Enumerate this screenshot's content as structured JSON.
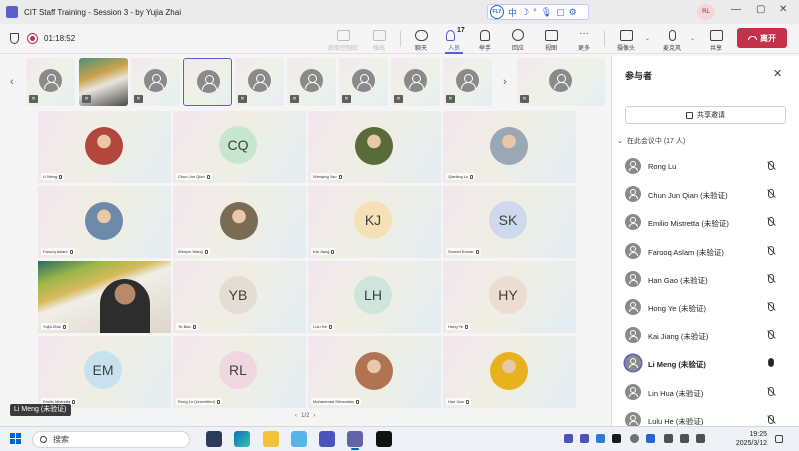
{
  "window": {
    "title": "CIT Staff Training - Session 3 - by Yujia Zhai",
    "user_initials": "RL"
  },
  "input_indicator": {
    "badge": "FLY",
    "glyphs": [
      "中",
      "☽",
      "°",
      "🎙",
      "▢",
      "⚙"
    ]
  },
  "toolbar": {
    "timer": "01:18:52",
    "buttons": [
      {
        "id": "take-control",
        "label": "获取控制权",
        "disabled": true
      },
      {
        "id": "popout",
        "label": "弹出",
        "disabled": true
      },
      {
        "id": "chat",
        "label": "聊天"
      },
      {
        "id": "people",
        "label": "人员",
        "count": "17",
        "active": true
      },
      {
        "id": "raise-hand",
        "label": "举手"
      },
      {
        "id": "react",
        "label": "回应"
      },
      {
        "id": "view",
        "label": "视图"
      },
      {
        "id": "more",
        "label": "更多"
      },
      {
        "id": "camera",
        "label": "摄像头"
      },
      {
        "id": "mic",
        "label": "麦克风"
      },
      {
        "id": "share",
        "label": "共享"
      }
    ],
    "leave_label": "离开"
  },
  "grid": {
    "tiles": [
      {
        "name": "Li Meng",
        "type": "photo",
        "color": "#b3473e"
      },
      {
        "name": "Chun Jun Qian",
        "type": "initials",
        "initials": "CQ",
        "bg": "#c8e6cf"
      },
      {
        "name": "Wenqing Yao",
        "type": "photo",
        "color": "#5a6b3a"
      },
      {
        "name": "Qianling Lu",
        "type": "photo",
        "color": "#9aa7b5"
      },
      {
        "name": "Farooq Aslam",
        "type": "photo",
        "color": "#6d8aa8"
      },
      {
        "name": "Wenyin Wang",
        "type": "photo",
        "color": "#7a6b55"
      },
      {
        "name": "Kai Jiang",
        "type": "initials",
        "initials": "KJ",
        "bg": "#f6e0b8"
      },
      {
        "name": "Suresh Kumar",
        "type": "initials",
        "initials": "SK",
        "bg": "#cfd9ee"
      },
      {
        "name": "Yujia Zhai",
        "type": "video"
      },
      {
        "name": "Ye Bao",
        "type": "initials",
        "initials": "YB",
        "bg": "#e4ddd2"
      },
      {
        "name": "Lulu He",
        "type": "initials",
        "initials": "LH",
        "bg": "#cfe4dd"
      },
      {
        "name": "Hong Ye",
        "type": "initials",
        "initials": "HY",
        "bg": "#ecdcd2"
      },
      {
        "name": "Emilio Mistretta",
        "type": "initials",
        "initials": "EM",
        "bg": "#c7e2ee"
      },
      {
        "name": "Rong Lu (Unverified)",
        "type": "initials",
        "initials": "RL",
        "bg": "#efd6df"
      },
      {
        "name": "Mohammad Shirzadian",
        "type": "photo",
        "color": "#b07453"
      },
      {
        "name": "Han Gao",
        "type": "photo",
        "color": "#e8b21e"
      }
    ]
  },
  "pager": {
    "text": "1/2"
  },
  "speaker_label": "Li Meng (未验证)",
  "panel": {
    "title": "参与者",
    "share_invite": "共享邀请",
    "section": "在此会议中 (17 人)",
    "participants": [
      {
        "name": "Rong Lu",
        "mic": "muted"
      },
      {
        "name": "Chun Jun Qian (未验证)",
        "mic": "muted"
      },
      {
        "name": "Emilio Mistretta (未验证)",
        "mic": "muted"
      },
      {
        "name": "Farooq Aslam (未验证)",
        "mic": "muted"
      },
      {
        "name": "Han Gao (未验证)",
        "mic": "muted"
      },
      {
        "name": "Hong Ye (未验证)",
        "mic": "muted"
      },
      {
        "name": "Kai Jiang (未验证)",
        "mic": "muted"
      },
      {
        "name": "Li Meng (未验证)",
        "mic": "on",
        "speaking": true
      },
      {
        "name": "Lin Hua (未验证)",
        "mic": "muted"
      },
      {
        "name": "Lulu He (未验证)",
        "mic": "muted"
      }
    ]
  },
  "taskbar": {
    "search_placeholder": "搜索",
    "time": "19:25",
    "date": "2025/3/12"
  }
}
